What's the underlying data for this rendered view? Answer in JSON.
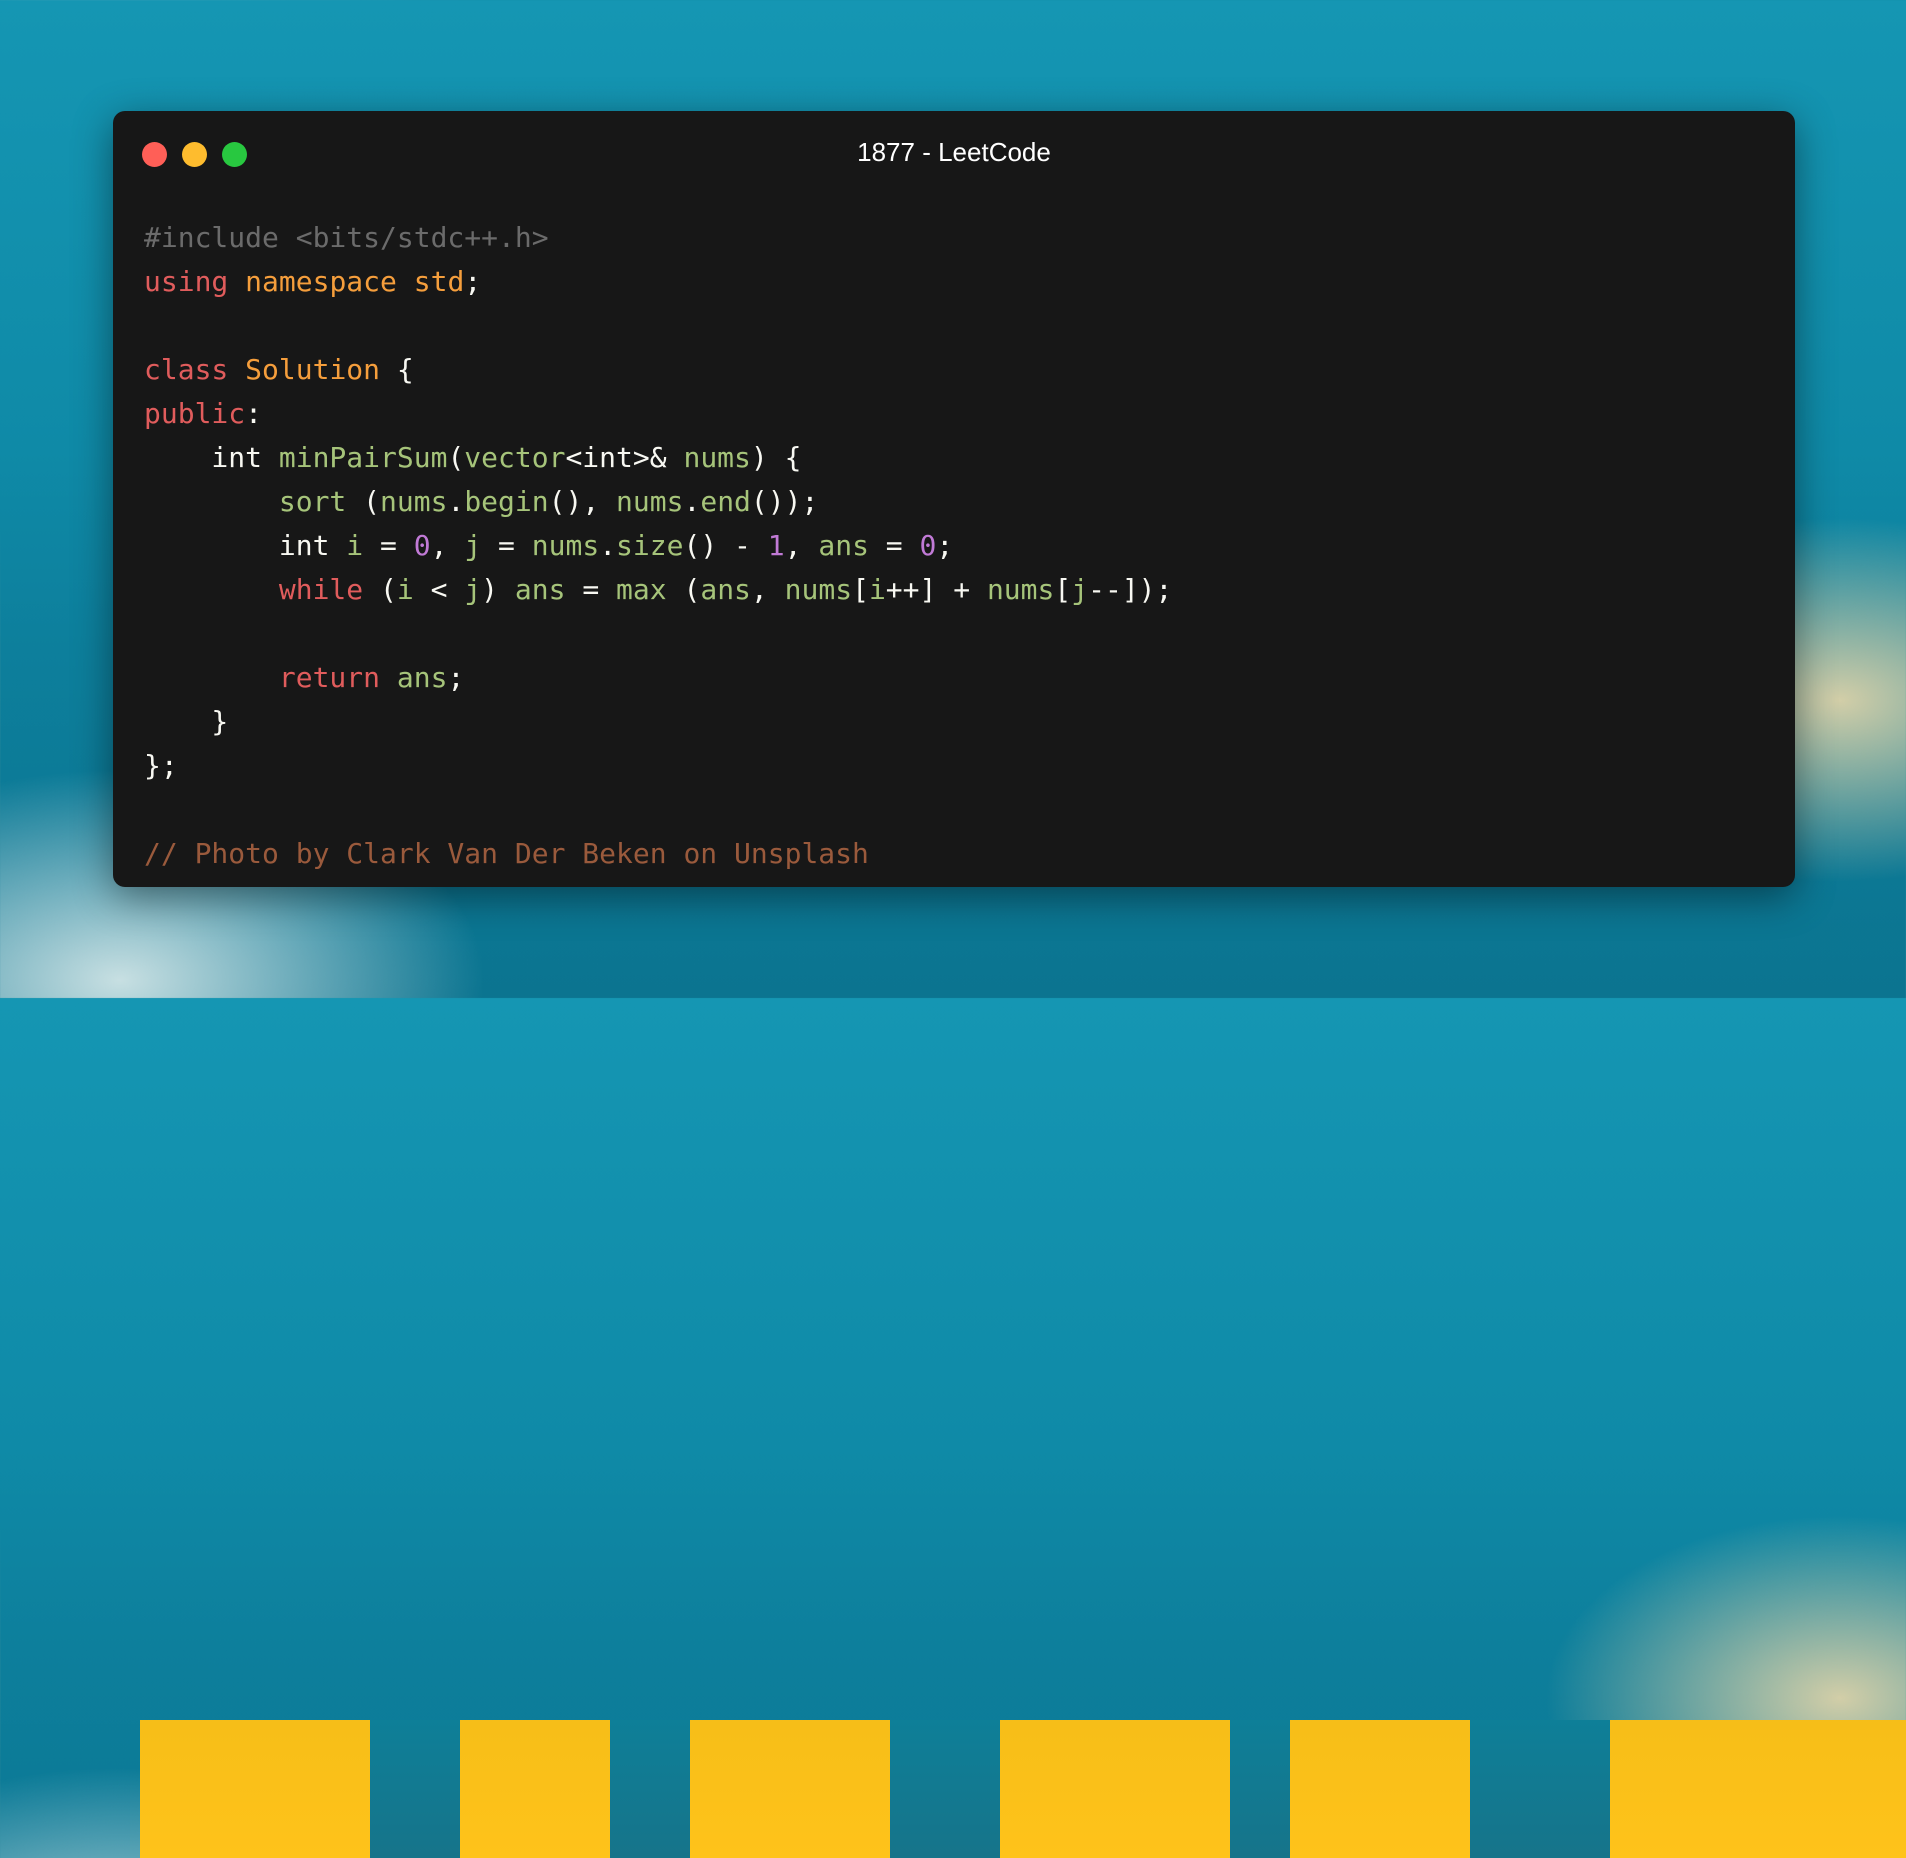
{
  "window": {
    "title": "1877 - LeetCode",
    "controls": [
      "close",
      "minimize",
      "maximize"
    ]
  },
  "colors": {
    "close": "#ff5f57",
    "minimize": "#febc2e",
    "maximize": "#28c840",
    "window_bg": "#171717",
    "keyword": "#e05c5c",
    "namespace": "#f59e3c",
    "function": "#a6c47a",
    "number": "#c17ad6",
    "comment": "#9a5a3c",
    "preprocessor": "#6b6b6b"
  },
  "code": {
    "lines": [
      [
        {
          "t": "#include <bits/stdc++.h>",
          "c": "dim"
        }
      ],
      [
        {
          "t": "using",
          "c": "kw"
        },
        {
          "t": " ",
          "c": "plain"
        },
        {
          "t": "namespace",
          "c": "ns"
        },
        {
          "t": " ",
          "c": "plain"
        },
        {
          "t": "std",
          "c": "ns"
        },
        {
          "t": ";",
          "c": "plain"
        }
      ],
      [],
      [
        {
          "t": "class",
          "c": "kw"
        },
        {
          "t": " ",
          "c": "plain"
        },
        {
          "t": "Solution",
          "c": "ns"
        },
        {
          "t": " {",
          "c": "plain"
        }
      ],
      [
        {
          "t": "public",
          "c": "kw"
        },
        {
          "t": ":",
          "c": "plain"
        }
      ],
      [
        {
          "t": "    int ",
          "c": "plain"
        },
        {
          "t": "minPairSum",
          "c": "fn"
        },
        {
          "t": "(",
          "c": "plain"
        },
        {
          "t": "vector",
          "c": "fn"
        },
        {
          "t": "<int>& ",
          "c": "plain"
        },
        {
          "t": "nums",
          "c": "fn"
        },
        {
          "t": ") {",
          "c": "plain"
        }
      ],
      [
        {
          "t": "        ",
          "c": "plain"
        },
        {
          "t": "sort",
          "c": "fn"
        },
        {
          "t": " (",
          "c": "plain"
        },
        {
          "t": "nums",
          "c": "fn"
        },
        {
          "t": ".",
          "c": "plain"
        },
        {
          "t": "begin",
          "c": "fn"
        },
        {
          "t": "(), ",
          "c": "plain"
        },
        {
          "t": "nums",
          "c": "fn"
        },
        {
          "t": ".",
          "c": "plain"
        },
        {
          "t": "end",
          "c": "fn"
        },
        {
          "t": "());",
          "c": "plain"
        }
      ],
      [
        {
          "t": "        int ",
          "c": "plain"
        },
        {
          "t": "i",
          "c": "fn"
        },
        {
          "t": " = ",
          "c": "plain"
        },
        {
          "t": "0",
          "c": "num"
        },
        {
          "t": ", ",
          "c": "plain"
        },
        {
          "t": "j",
          "c": "fn"
        },
        {
          "t": " = ",
          "c": "plain"
        },
        {
          "t": "nums",
          "c": "fn"
        },
        {
          "t": ".",
          "c": "plain"
        },
        {
          "t": "size",
          "c": "fn"
        },
        {
          "t": "() - ",
          "c": "plain"
        },
        {
          "t": "1",
          "c": "num"
        },
        {
          "t": ", ",
          "c": "plain"
        },
        {
          "t": "ans",
          "c": "fn"
        },
        {
          "t": " = ",
          "c": "plain"
        },
        {
          "t": "0",
          "c": "num"
        },
        {
          "t": ";",
          "c": "plain"
        }
      ],
      [
        {
          "t": "        ",
          "c": "plain"
        },
        {
          "t": "while",
          "c": "kw"
        },
        {
          "t": " (",
          "c": "plain"
        },
        {
          "t": "i",
          "c": "fn"
        },
        {
          "t": " < ",
          "c": "plain"
        },
        {
          "t": "j",
          "c": "fn"
        },
        {
          "t": ") ",
          "c": "plain"
        },
        {
          "t": "ans",
          "c": "fn"
        },
        {
          "t": " = ",
          "c": "plain"
        },
        {
          "t": "max",
          "c": "fn"
        },
        {
          "t": " (",
          "c": "plain"
        },
        {
          "t": "ans",
          "c": "fn"
        },
        {
          "t": ", ",
          "c": "plain"
        },
        {
          "t": "nums",
          "c": "fn"
        },
        {
          "t": "[",
          "c": "plain"
        },
        {
          "t": "i",
          "c": "fn"
        },
        {
          "t": "++] + ",
          "c": "plain"
        },
        {
          "t": "nums",
          "c": "fn"
        },
        {
          "t": "[",
          "c": "plain"
        },
        {
          "t": "j",
          "c": "fn"
        },
        {
          "t": "--]);",
          "c": "plain"
        }
      ],
      [],
      [
        {
          "t": "        ",
          "c": "plain"
        },
        {
          "t": "return",
          "c": "kw"
        },
        {
          "t": " ",
          "c": "plain"
        },
        {
          "t": "ans",
          "c": "fn"
        },
        {
          "t": ";",
          "c": "plain"
        }
      ],
      [
        {
          "t": "    }",
          "c": "plain"
        }
      ],
      [
        {
          "t": "};",
          "c": "plain"
        }
      ],
      [],
      [
        {
          "t": "// Photo by Clark Van Der Beken on Unsplash",
          "c": "comment"
        }
      ]
    ]
  }
}
